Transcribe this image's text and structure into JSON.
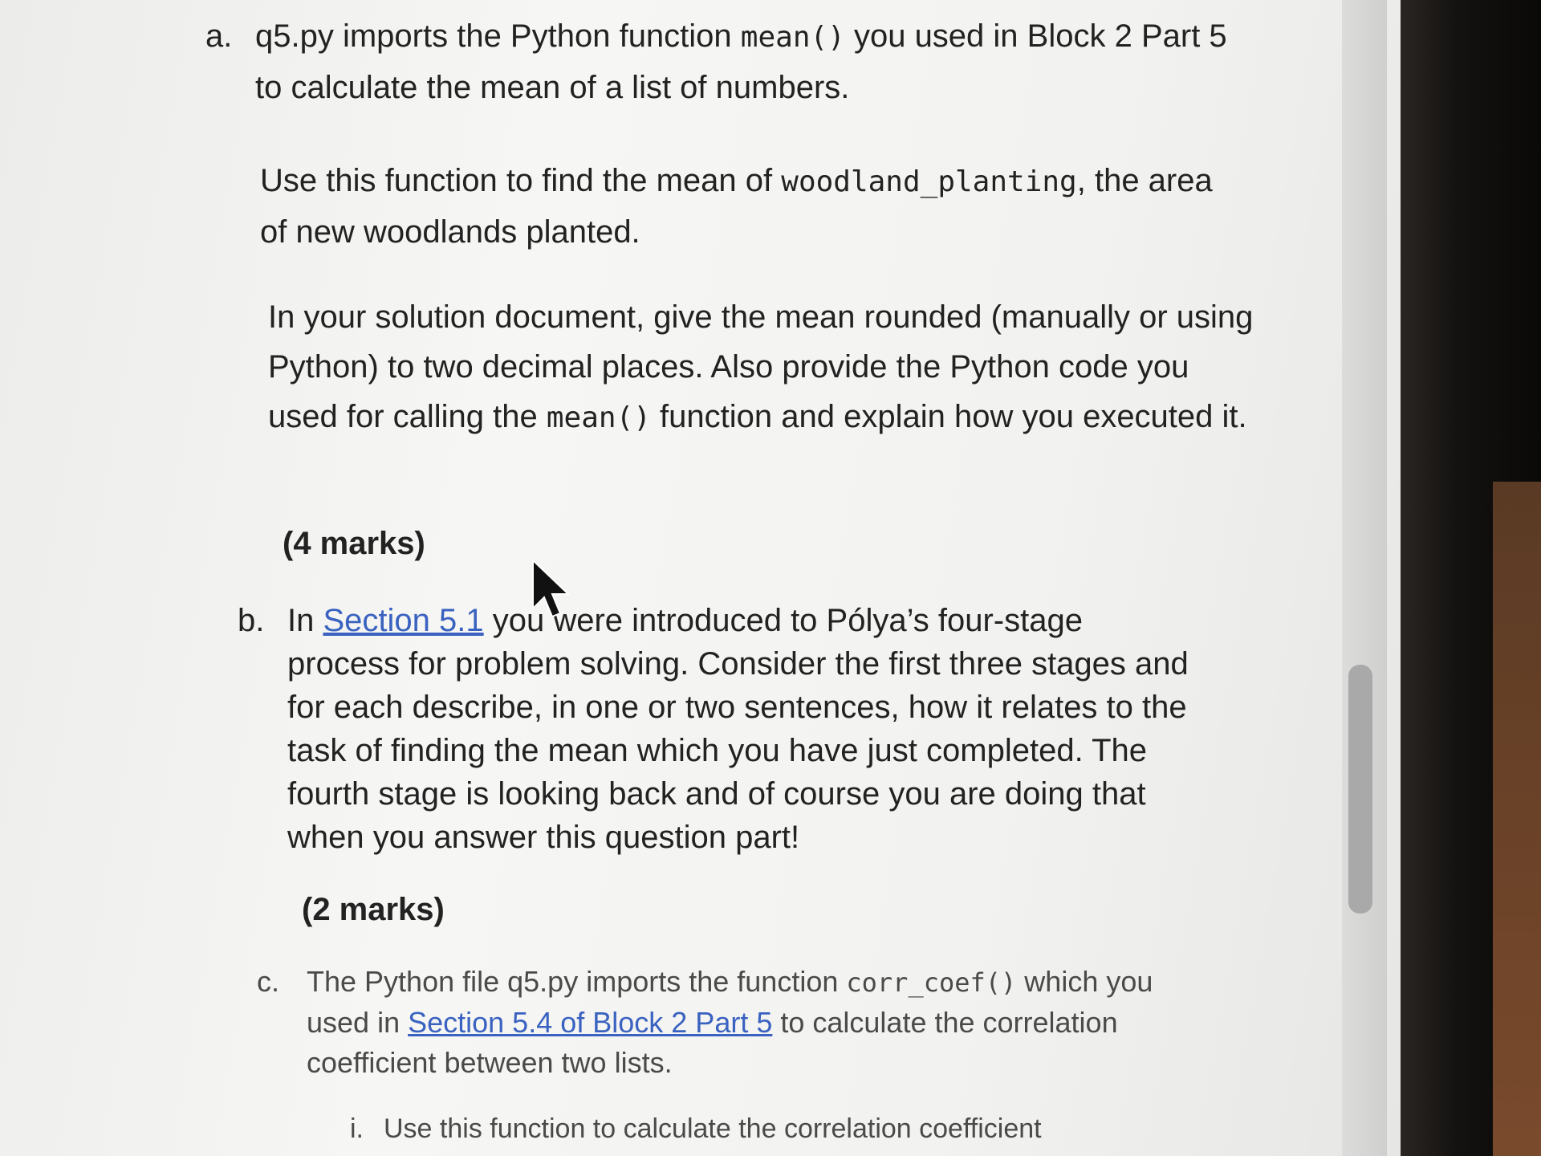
{
  "part_a": {
    "marker": "a.",
    "intro_1": "q5.py imports the Python function ",
    "intro_code": "mean()",
    "intro_2": " you used in Block 2 Part 5 to calculate the mean of a list of numbers.",
    "para2_1": "Use this function to find the mean of ",
    "para2_code": "woodland_planting",
    "para2_2": ", the area of new woodlands planted.",
    "para3_1": "In your solution document, give the mean rounded (manually or using Python) to two decimal places. Also provide the Python code you used for calling the ",
    "para3_code": "mean()",
    "para3_2": " function and explain how you executed it.",
    "marks": "(4 marks)"
  },
  "part_b": {
    "marker": "b.",
    "text_1": "In ",
    "link": "Section 5.1",
    "text_2": " you were introduced to Pólya’s four-stage process for problem solving. Consider the first three stages and for each describe, in one or two sentences, how it relates to the task of finding the mean which you have just completed. The fourth stage is looking back and of course you are doing that when you answer this question part!",
    "marks": "(2 marks)"
  },
  "part_c": {
    "marker": "c.",
    "text_1": "The Python file q5.py imports the function ",
    "code": "corr_coef()",
    "text_2": " which you used in ",
    "link": "Section 5.4 of Block 2 Part 5",
    "text_3": " to calculate the correlation coefficient between two lists."
  },
  "part_c_i": {
    "marker": "i.",
    "text": "Use this function to calculate the correlation coefficient"
  },
  "colors": {
    "link": "#3a62c0",
    "text": "#222222"
  }
}
